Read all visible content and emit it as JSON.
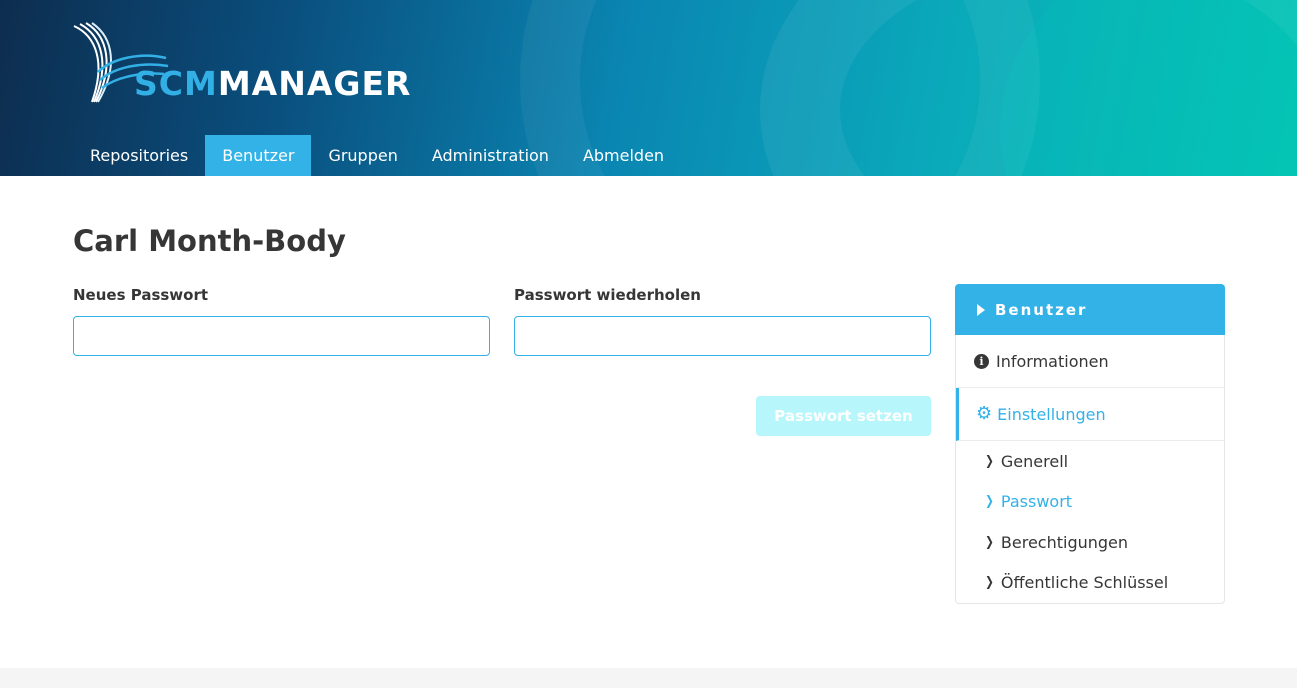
{
  "header": {
    "logo": {
      "scm": "SCM",
      "manager": "MANAGER"
    },
    "nav": [
      {
        "label": "Repositories",
        "active": false
      },
      {
        "label": "Benutzer",
        "active": true
      },
      {
        "label": "Gruppen",
        "active": false
      },
      {
        "label": "Administration",
        "active": false
      },
      {
        "label": "Abmelden",
        "active": false
      }
    ]
  },
  "main": {
    "title": "Carl Month-Body",
    "form": {
      "new_password_label": "Neues Passwort",
      "new_password_value": "",
      "repeat_password_label": "Passwort wiederholen",
      "repeat_password_value": "",
      "submit_label": "Passwort setzen"
    }
  },
  "sidebar": {
    "header": "Benutzer",
    "items": [
      {
        "label": "Informationen",
        "icon": "info-circle-icon"
      },
      {
        "label": "Einstellungen",
        "icon": "gear-icon",
        "current": true
      }
    ],
    "sub_items": [
      {
        "label": "Generell"
      },
      {
        "label": "Passwort",
        "current": true
      },
      {
        "label": "Berechtigungen"
      },
      {
        "label": "Öffentliche Schlüssel"
      }
    ]
  },
  "colors": {
    "accent": "#33b2e8",
    "text": "#363636",
    "disabled_button": "#b7f6fb"
  }
}
